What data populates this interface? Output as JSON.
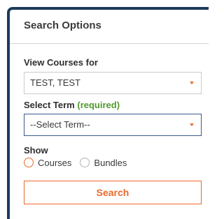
{
  "search_options": {
    "title": "Search Options",
    "view_courses": {
      "label": "View Courses for",
      "value": "TEST, TEST"
    },
    "term": {
      "label": "Select Term",
      "required_text": "(required)",
      "value": "--Select Term--"
    },
    "show": {
      "label": "Show",
      "options": [
        "Courses",
        "Bundles"
      ]
    },
    "search_button": "Search"
  },
  "colors": {
    "panel_border": "#1b3b5a",
    "accent": "#e8692a",
    "required": "#4f9a2e",
    "focus_border": "#3b5b8e"
  }
}
